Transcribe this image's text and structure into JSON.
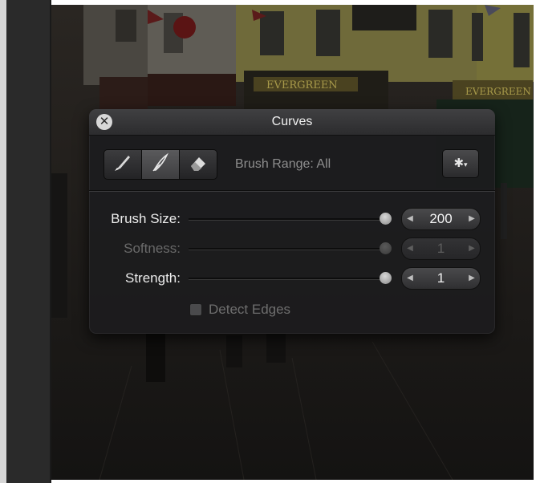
{
  "panel": {
    "title": "Curves",
    "close_icon": "close-icon",
    "brush_range_label": "Brush Range: All",
    "brush_buttons": [
      {
        "icon": "brush-icon",
        "active": false
      },
      {
        "icon": "feather-brush-icon",
        "active": true
      },
      {
        "icon": "eraser-icon",
        "active": false
      }
    ],
    "gear_icon": "gear-icon"
  },
  "controls": {
    "brush_size": {
      "label": "Brush Size:",
      "value": "200",
      "enabled": true
    },
    "softness": {
      "label": "Softness:",
      "value": "1",
      "enabled": false
    },
    "strength": {
      "label": "Strength:",
      "value": "1",
      "enabled": true
    },
    "detect_edges": {
      "label": "Detect Edges",
      "checked": false,
      "enabled": false
    }
  },
  "photo": {
    "signs": [
      "EVERGREEN",
      "EVERGREEN"
    ]
  },
  "colors": {
    "accent": "#e6e6e6",
    "hud_bg": "#1c1c1e"
  }
}
